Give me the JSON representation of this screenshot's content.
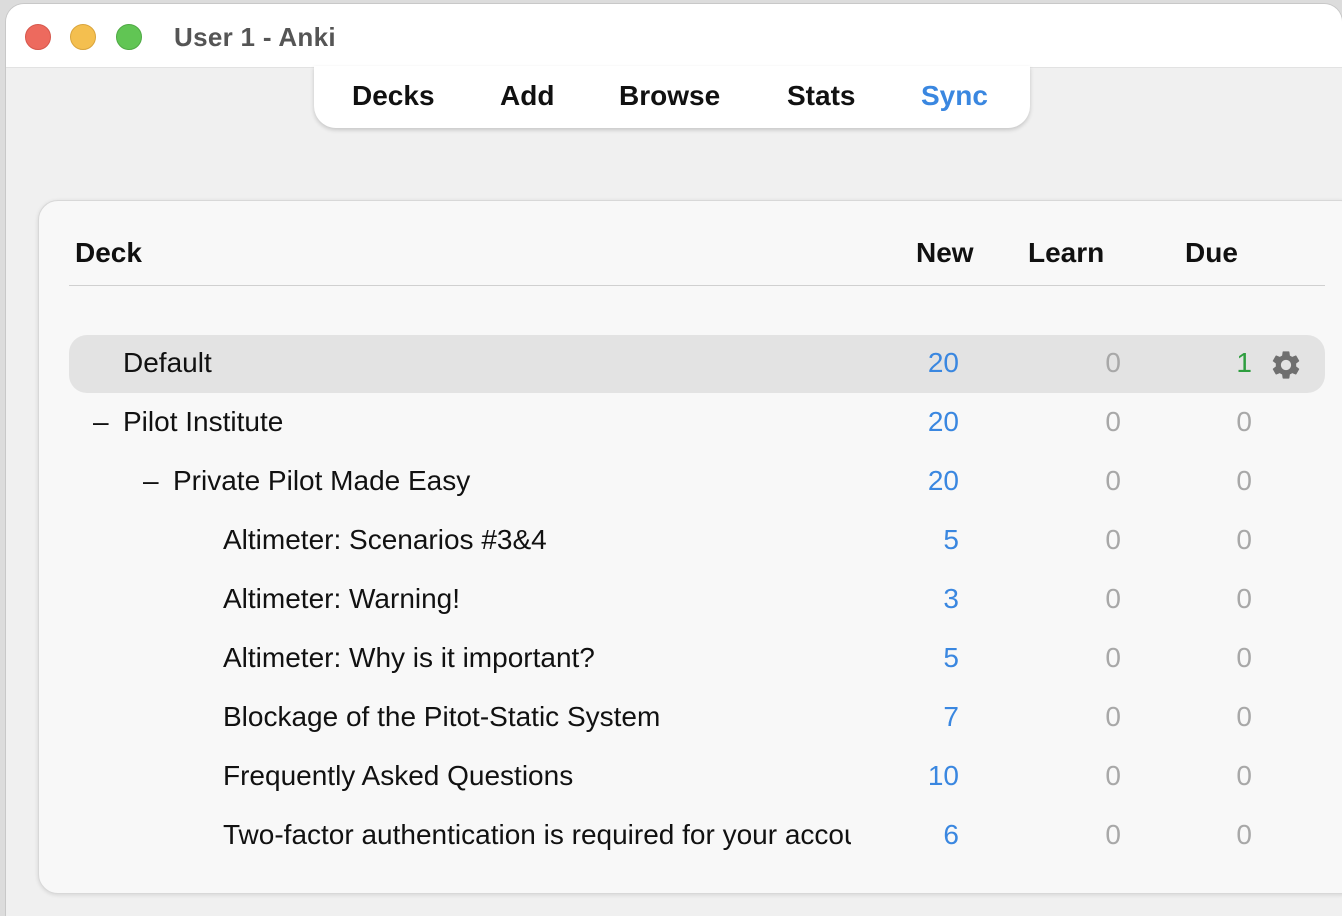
{
  "window": {
    "title": "User 1 - Anki"
  },
  "toolbar": {
    "decks": "Decks",
    "add": "Add",
    "browse": "Browse",
    "stats": "Stats",
    "sync": "Sync"
  },
  "columns": {
    "deck": "Deck",
    "new": "New",
    "learn": "Learn",
    "due": "Due"
  },
  "colors": {
    "new": "#3a87e0",
    "learn": "#a8a8a8",
    "due_nonzero": "#2e9e3f",
    "due_zero": "#a8a8a8",
    "sync_accent": "#3a87e0"
  },
  "decks": [
    {
      "name": "Default",
      "depth": 0,
      "toggle": "",
      "new": "20",
      "learn": "0",
      "due": "1",
      "current": true,
      "gear": "gear-icon"
    },
    {
      "name": "Pilot Institute",
      "depth": 0,
      "toggle": "–",
      "new": "20",
      "learn": "0",
      "due": "0",
      "current": false
    },
    {
      "name": "Private Pilot Made Easy",
      "depth": 1,
      "toggle": "–",
      "new": "20",
      "learn": "0",
      "due": "0",
      "current": false
    },
    {
      "name": "Altimeter: Scenarios #3&4",
      "depth": 2,
      "toggle": "",
      "new": "5",
      "learn": "0",
      "due": "0",
      "current": false
    },
    {
      "name": "Altimeter: Warning!",
      "depth": 2,
      "toggle": "",
      "new": "3",
      "learn": "0",
      "due": "0",
      "current": false
    },
    {
      "name": "Altimeter: Why is it important?",
      "depth": 2,
      "toggle": "",
      "new": "5",
      "learn": "0",
      "due": "0",
      "current": false
    },
    {
      "name": "Blockage of the Pitot-Static System",
      "depth": 2,
      "toggle": "",
      "new": "7",
      "learn": "0",
      "due": "0",
      "current": false
    },
    {
      "name": "Frequently Asked Questions",
      "depth": 2,
      "toggle": "",
      "new": "10",
      "learn": "0",
      "due": "0",
      "current": false
    },
    {
      "name": "Two-factor authentication is required for your account",
      "depth": 2,
      "toggle": "",
      "new": "6",
      "learn": "0",
      "due": "0",
      "current": false
    }
  ]
}
